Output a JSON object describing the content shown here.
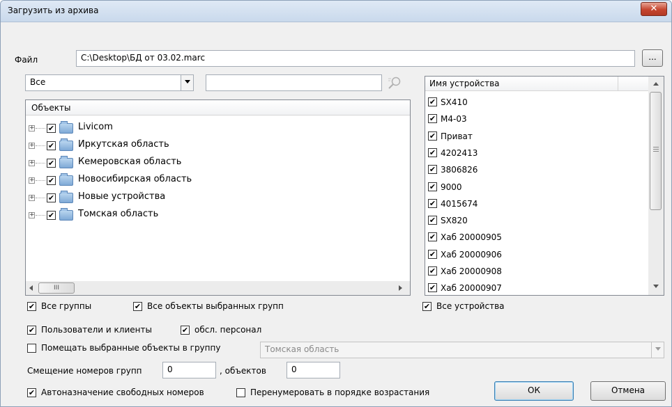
{
  "window": {
    "title": "Загрузить из архива",
    "close_glyph": "✕"
  },
  "file": {
    "label": "Файл",
    "value": "C:\\Desktop\\БД от 03.02.marc",
    "browse_label": "..."
  },
  "filter": {
    "selected": "Все",
    "search_value": "",
    "search_icon": "magnifier-icon"
  },
  "objects": {
    "header": "Объекты",
    "items": [
      {
        "label": "Livicom",
        "checked": true
      },
      {
        "label": "Иркутская область",
        "checked": true
      },
      {
        "label": "Кемеровская область",
        "checked": true
      },
      {
        "label": "Новосибирская область",
        "checked": true
      },
      {
        "label": "Новые устройства",
        "checked": true
      },
      {
        "label": "Томская область",
        "checked": true
      }
    ],
    "hscroll_thumb_glyph": "III"
  },
  "devices": {
    "header": "Имя устройства",
    "items": [
      {
        "label": "SX410",
        "checked": true
      },
      {
        "label": "M4-03",
        "checked": true
      },
      {
        "label": "Приват",
        "checked": true
      },
      {
        "label": "4202413",
        "checked": true
      },
      {
        "label": "3806826",
        "checked": true
      },
      {
        "label": "9000",
        "checked": true
      },
      {
        "label": "4015674",
        "checked": true
      },
      {
        "label": "SX820",
        "checked": true
      },
      {
        "label": "Хаб 20000905",
        "checked": true
      },
      {
        "label": "Хаб 20000906",
        "checked": true
      },
      {
        "label": "Хаб 20000908",
        "checked": true
      },
      {
        "label": "Хаб 20000907",
        "checked": true
      }
    ]
  },
  "options": {
    "all_groups": "Все группы",
    "all_objects_selected_groups": "Все объекты выбранных групп",
    "all_devices": "Все устройства",
    "users_clients": "Пользователи и клиенты",
    "service_staff": "обсл. персонал",
    "place_in_group": "Помещать выбранные объекты в группу",
    "place_in_group_checked": false,
    "group_select_value": "Томская область",
    "offset_groups_label": "Смещение номеров групп",
    "offset_groups_value": "0",
    "offset_objects_label": ", объектов",
    "offset_objects_value": "0",
    "auto_assign": "Автоназначение свободных номеров",
    "auto_assign_checked": true,
    "renumber": "Перенумеровать в порядке возрастания",
    "renumber_checked": false
  },
  "buttons": {
    "ok": "ОК",
    "cancel": "Отмена"
  },
  "check_glyph": "✔"
}
